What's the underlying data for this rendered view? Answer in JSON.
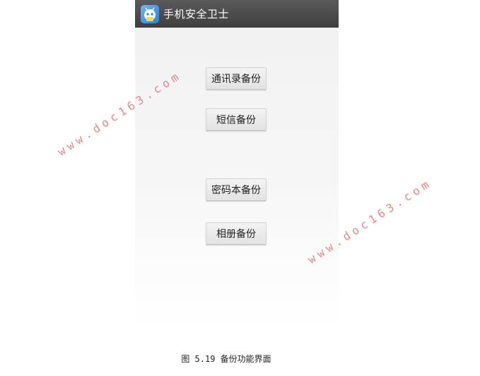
{
  "app": {
    "title": "手机安全卫士",
    "icon": "robot-icon"
  },
  "buttons": {
    "contacts_backup": "通讯录备份",
    "sms_backup": "短信备份",
    "password_backup": "密码本备份",
    "album_backup": "相册备份"
  },
  "watermarks": [
    "www.doc163.com",
    "www.doc163.com"
  ],
  "caption": "图 5.19 备份功能界面",
  "colors": {
    "action_bar": "#4a4a4a",
    "watermark": "#e07b7b",
    "button_bg": "#e8e8e8"
  }
}
